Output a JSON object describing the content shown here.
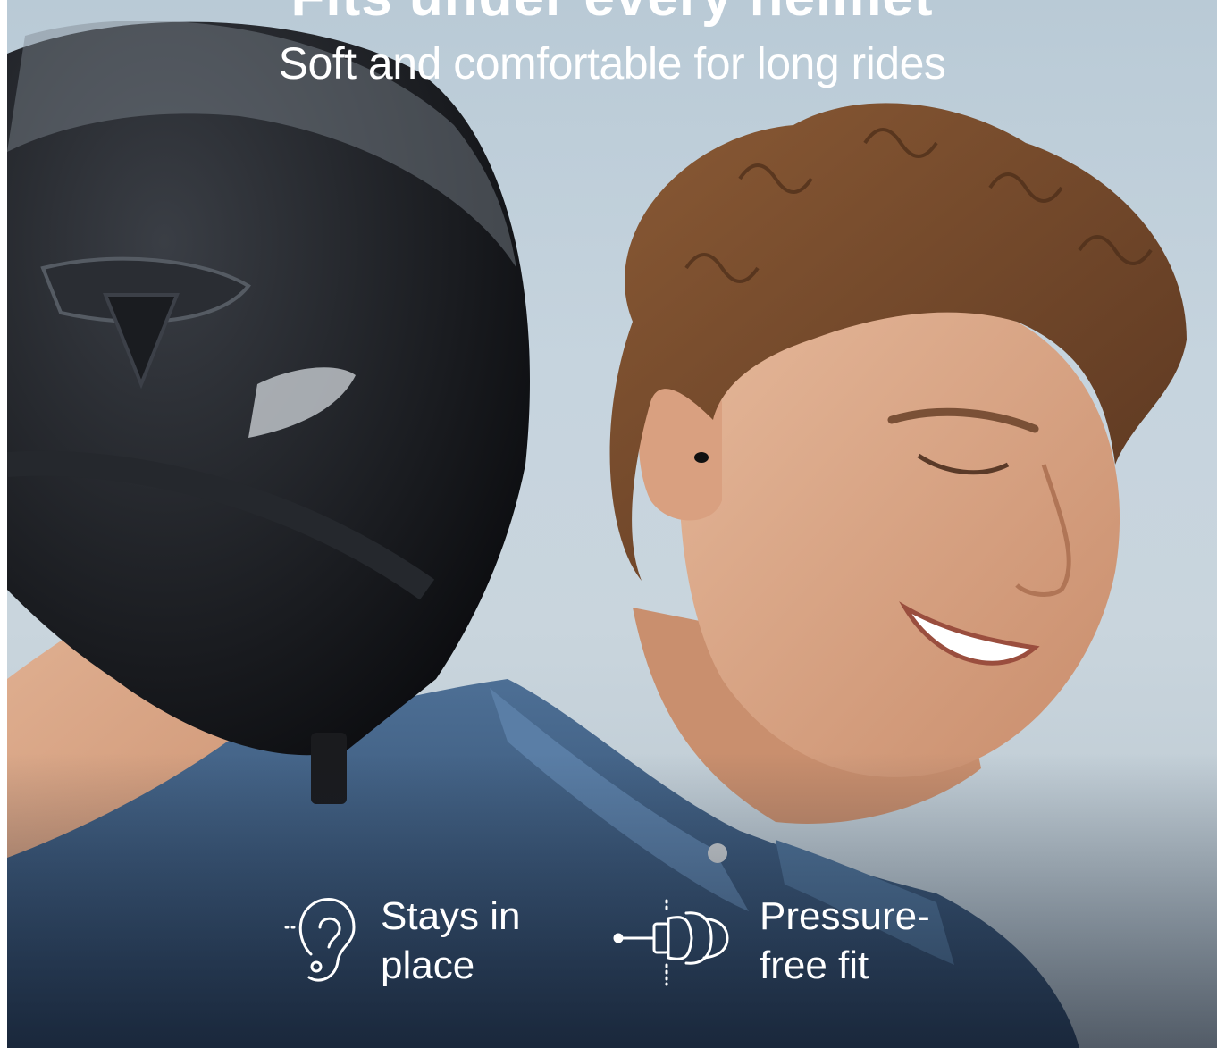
{
  "headline": "Fits under every helmet",
  "subheadline": "Soft and comfortable for long rides",
  "features": [
    {
      "label_line1": "Stays in",
      "label_line2": "place",
      "icon": "ear-icon"
    },
    {
      "label_line1": "Pressure-",
      "label_line2": "free fit",
      "icon": "earplug-icon"
    }
  ],
  "colors": {
    "sky": "#c6d4de",
    "text": "#ffffff",
    "denim": "#3e5f84",
    "helmet": "#111316"
  }
}
